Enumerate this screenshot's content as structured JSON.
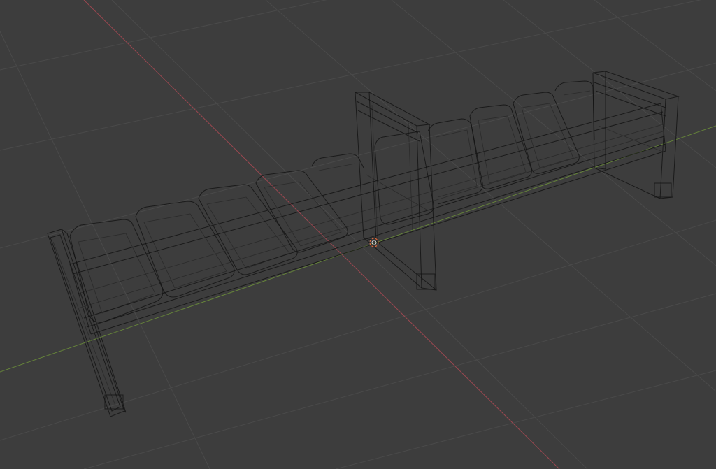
{
  "viewport": {
    "mode": "wireframe",
    "background_color": "#3d3d3d",
    "grid_color": "#4a4a4a",
    "x_axis_color": "#b34a55",
    "y_axis_color": "#6c8f3a",
    "wire_color": "#141414",
    "origin_cursor_color": "#e06a3c"
  },
  "icons": {
    "origin": "3d-cursor-icon"
  }
}
